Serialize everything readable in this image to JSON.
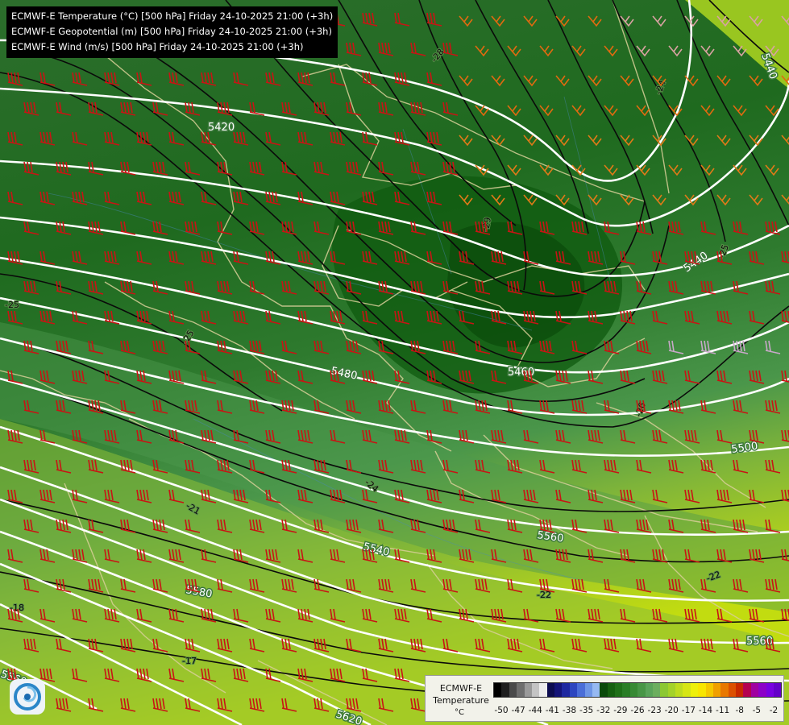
{
  "header": {
    "line1": "ECMWF-E Temperature (°C) [500 hPa] Friday 24-10-2025 21:00 (+3h)",
    "line2": "ECMWF-E Geopotential (m) [500 hPa] Friday 24-10-2025 21:00 (+3h)",
    "line3": "ECMWF-E Wind (m/s) [500 hPa] Friday 24-10-2025 21:00 (+3h)"
  },
  "geopotential_labels": [
    "5420",
    "5440",
    "5460",
    "5480",
    "5500",
    "5540",
    "5560",
    "5580",
    "5560",
    "5560",
    "5620",
    "5440"
  ],
  "temperature_labels": [
    "-28",
    "-29",
    "-25",
    "-26",
    "-25",
    "-24",
    "-21",
    "-22",
    "-22",
    "-18",
    "-17",
    "-25",
    "-24"
  ],
  "legend": {
    "title_line1": "ECMWF-E",
    "title_line2": "Temperature",
    "unit": "°C",
    "ticks": [
      "-50",
      "-47",
      "-44",
      "-41",
      "-38",
      "-35",
      "-32",
      "-29",
      "-26",
      "-23",
      "-20",
      "-17",
      "-14",
      "-11",
      "-8",
      "-5",
      "-2"
    ],
    "colors": [
      "#000000",
      "#1e1e1e",
      "#4a4a4a",
      "#6e6e6e",
      "#9a9a9a",
      "#c4c4c4",
      "#ececec",
      "#0c0c50",
      "#141478",
      "#1e28a0",
      "#2d46c0",
      "#4a6ed8",
      "#6e96e6",
      "#96b9f2",
      "#0a4a0a",
      "#15600f",
      "#1f7018",
      "#2a7e26",
      "#388a34",
      "#489646",
      "#5aa45a",
      "#6cae5e",
      "#8cc832",
      "#a4d228",
      "#bedc1e",
      "#d6e614",
      "#eef00a",
      "#f8e600",
      "#f5c800",
      "#f0a000",
      "#e87800",
      "#dc5000",
      "#c82800",
      "#b40050",
      "#a000a0",
      "#8c00c8",
      "#7800e0",
      "#6400c8"
    ]
  },
  "logo": {
    "name": "meteo-logo"
  }
}
